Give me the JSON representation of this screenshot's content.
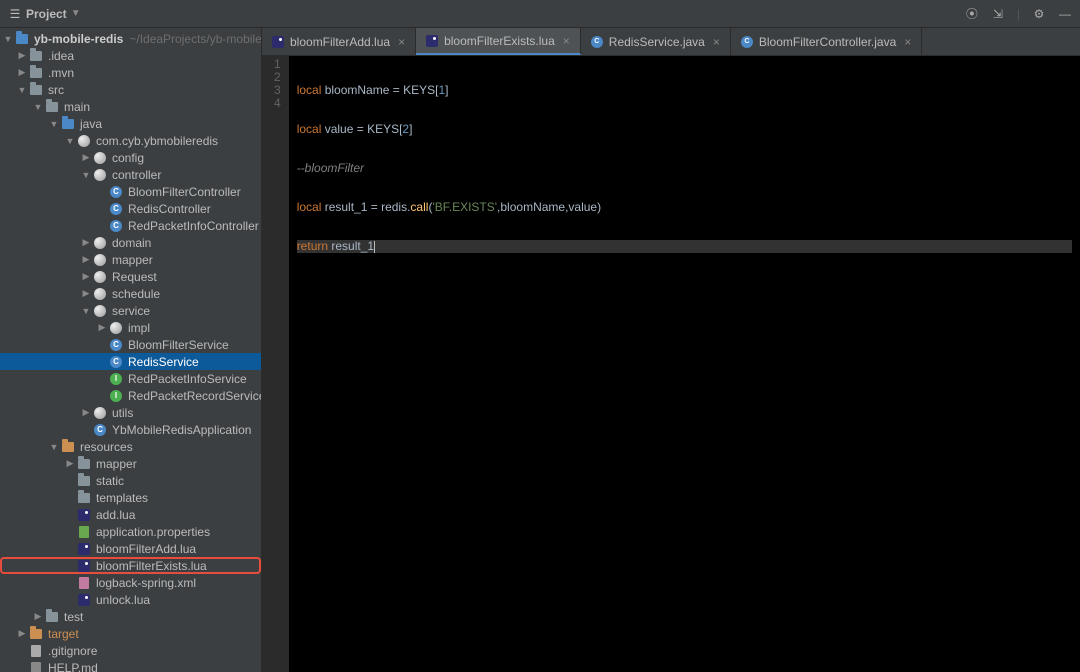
{
  "toolbar": {
    "project_label": "Project"
  },
  "project": {
    "root": {
      "name": "yb-mobile-redis",
      "path": "~/IdeaProjects/yb-mobile-r"
    },
    "idea": ".idea",
    "mvn": ".mvn",
    "src": "src",
    "main": "main",
    "java": "java",
    "package": "com.cyb.ybmobileredis",
    "config": "config",
    "controller": "controller",
    "ctrl1": "BloomFilterController",
    "ctrl2": "RedisController",
    "ctrl3": "RedPacketInfoController",
    "domain": "domain",
    "mapper": "mapper",
    "request": "Request",
    "schedule": "schedule",
    "service": "service",
    "impl": "impl",
    "svc1": "BloomFilterService",
    "svc2": "RedisService",
    "svc3": "RedPacketInfoService",
    "svc4": "RedPacketRecordService",
    "utils": "utils",
    "app": "YbMobileRedisApplication",
    "resources": "resources",
    "res_mapper": "mapper",
    "static": "static",
    "templates": "templates",
    "addlua": "add.lua",
    "appprops": "application.properties",
    "bfadd": "bloomFilterAdd.lua",
    "bfexists": "bloomFilterExists.lua",
    "logback": "logback-spring.xml",
    "unlock": "unlock.lua",
    "test": "test",
    "target": "target",
    "gitignore": ".gitignore",
    "help": "HELP.md"
  },
  "tabs": {
    "t1": "bloomFilterAdd.lua",
    "t2": "bloomFilterExists.lua",
    "t3": "RedisService.java",
    "t4": "BloomFilterController.java"
  },
  "code": {
    "l1": {
      "kw1": "local",
      "v1": " bloomName = KEYS[",
      "n1": "1",
      "v2": "]"
    },
    "l2": {
      "kw1": "local",
      "v1": " value = KEYS[",
      "n1": "2",
      "v2": "]"
    },
    "l3": {
      "com": "--bloomFilter"
    },
    "l4": {
      "kw1": "local",
      "v1": " result_1 = redis.",
      "fn": "call",
      "p1": "(",
      "s1": "'BF.EXISTS'",
      "p2": ",bloomName,value)"
    },
    "l5": {
      "kw1": "return",
      "v1": " result_1"
    }
  },
  "gutter": [
    "1",
    "2",
    "3",
    "4"
  ]
}
